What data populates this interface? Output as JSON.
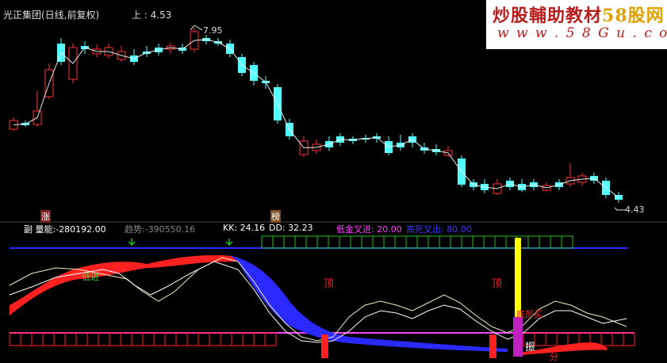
{
  "header": {
    "title": "光正集团(日线,前复权)",
    "price_label": "上 : 4.53"
  },
  "watermark": {
    "line1_prefix": "炒股輔助教材",
    "line1_brand": "58股网",
    "line2": "w w w . 5 8 G u . c o m"
  },
  "price_chart": {
    "high_label": "7.95",
    "low_label": "4.43",
    "tags": [
      "涨",
      "榜"
    ]
  },
  "indicator": {
    "prefix": "副",
    "items": [
      {
        "label": "量能",
        "value": "-280192.00",
        "color": "#ffffff"
      },
      {
        "label": "趋势",
        "value": "-390550.16",
        "color": "#888888"
      },
      {
        "label": "KK",
        "value": "24.16",
        "color": "#ffffff"
      },
      {
        "label": "DD",
        "value": "32.23",
        "color": "#ffffff"
      },
      {
        "label": "低金叉进",
        "value": "20.00",
        "color": "#ff40ff"
      },
      {
        "label": "高死叉出",
        "value": "80.00",
        "color": "#3a3aff"
      }
    ],
    "annotations": {
      "cross_up": "低进",
      "top1": "顶",
      "top2": "顶",
      "bottom_buy": "底部买",
      "zhen": "振",
      "fen": "分"
    }
  },
  "colors": {
    "up": "#ff3333",
    "down": "#54ffff",
    "band_blue": "#2a2aff",
    "band_red": "#ff2020",
    "green": "#20c020",
    "magenta": "#ff40ff",
    "yellow": "#ffff00"
  }
}
